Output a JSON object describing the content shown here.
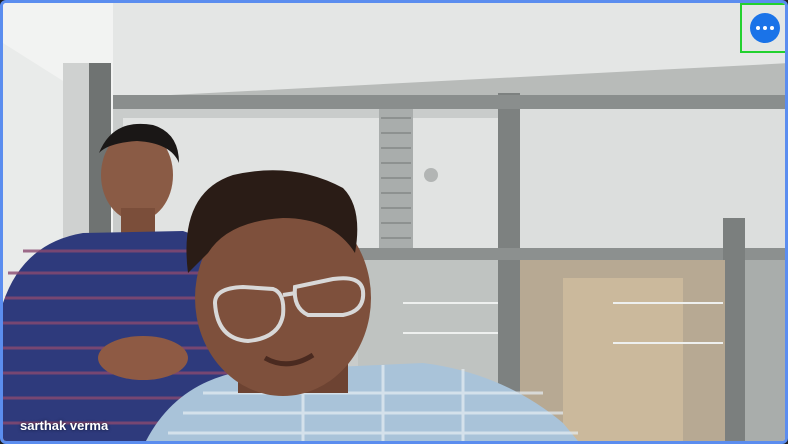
{
  "participant": {
    "name": "sarthak verma"
  },
  "controls": {
    "more_options_icon": "more-horizontal-icon",
    "more_options_color": "#1a73e8"
  },
  "tile": {
    "active_speaker_border_color": "#5b8def"
  }
}
